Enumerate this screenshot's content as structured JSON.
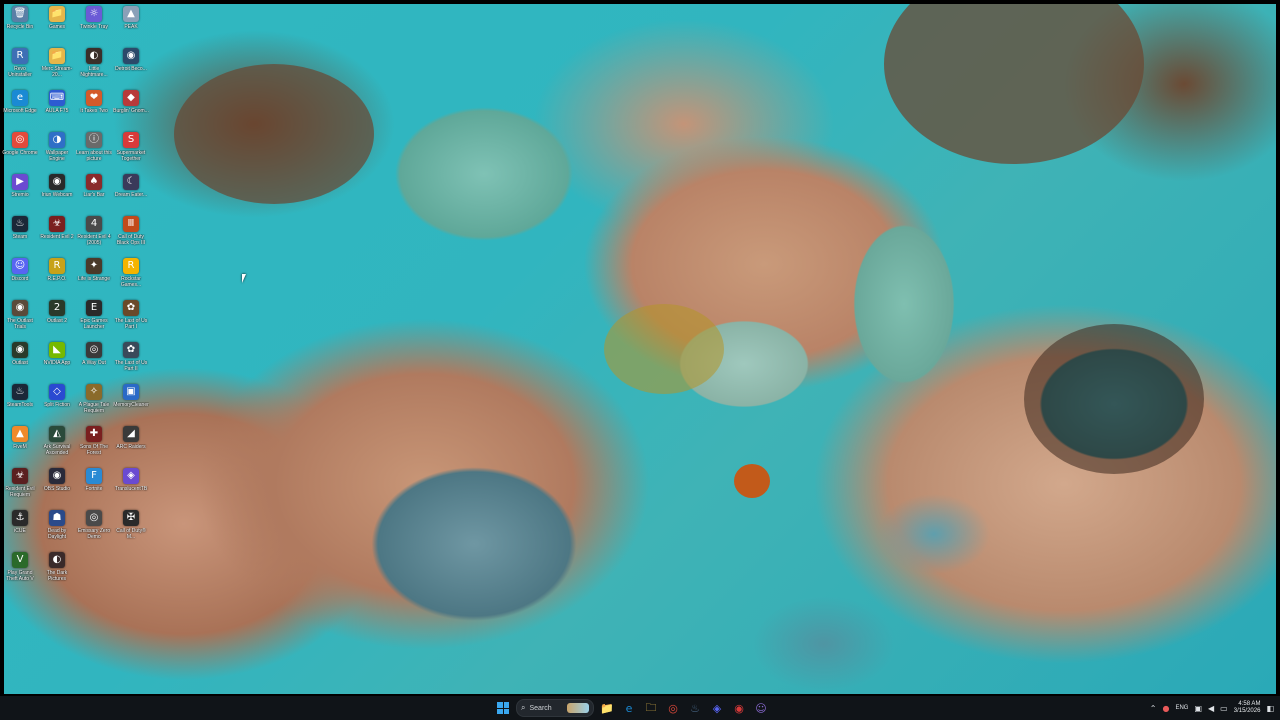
{
  "desktop": {
    "icons": [
      {
        "label": "Recycle Bin",
        "glyph": "🗑",
        "color": "#5a7fa6",
        "icon": "recycle-bin-icon"
      },
      {
        "label": "Games",
        "glyph": "📁",
        "color": "#e6b64a",
        "icon": "folder-icon"
      },
      {
        "label": "Twinkle Tray",
        "glyph": "☼",
        "color": "#6b5bd6",
        "icon": "twinkle-tray-icon"
      },
      {
        "label": "PEAK",
        "glyph": "▲",
        "color": "#8aa0b8",
        "icon": "peak-icon"
      },
      {
        "label": "Revo Uninstaller",
        "glyph": "R",
        "color": "#3d6fb5",
        "icon": "revo-icon"
      },
      {
        "label": "Merc Stream-20...",
        "glyph": "📁",
        "color": "#e6b64a",
        "icon": "folder-icon"
      },
      {
        "label": "Little Nightmare...",
        "glyph": "◐",
        "color": "#3a2f2a",
        "icon": "little-nightmares-icon"
      },
      {
        "label": "Detroit Beco...",
        "glyph": "◉",
        "color": "#2b4a6a",
        "icon": "detroit-icon"
      },
      {
        "label": "Microsoft Edge",
        "glyph": "e",
        "color": "#1a8ad4",
        "icon": "edge-icon"
      },
      {
        "label": "AULA F75",
        "glyph": "⌨",
        "color": "#2d5bd1",
        "icon": "aula-icon"
      },
      {
        "label": "It Takes Two",
        "glyph": "❤",
        "color": "#d45a2a",
        "icon": "it-takes-two-icon"
      },
      {
        "label": "Burglin' Gnom...",
        "glyph": "◆",
        "color": "#b83a3a",
        "icon": "burglin-gnomes-icon"
      },
      {
        "label": "Google Chrome",
        "glyph": "◎",
        "color": "#e34a3b",
        "icon": "chrome-icon"
      },
      {
        "label": "Wallpaper Engine",
        "glyph": "◑",
        "color": "#2f6fc7",
        "icon": "wallpaper-engine-icon"
      },
      {
        "label": "Learn about this picture",
        "glyph": "ⓘ",
        "color": "#6a6a6a",
        "icon": "info-icon"
      },
      {
        "label": "Supermarket Together",
        "glyph": "S",
        "color": "#d83a3a",
        "icon": "supermarket-icon"
      },
      {
        "label": "Stremio",
        "glyph": "▶",
        "color": "#6b4bd1",
        "icon": "stremio-icon"
      },
      {
        "label": "Iriun Webcam",
        "glyph": "◉",
        "color": "#2a2a2a",
        "icon": "webcam-icon"
      },
      {
        "label": "Liar's Bar",
        "glyph": "♠",
        "color": "#8a2b2b",
        "icon": "liars-bar-icon"
      },
      {
        "label": "Dream Eater...",
        "glyph": "☾",
        "color": "#3a3a5a",
        "icon": "dream-icon"
      },
      {
        "label": "Steam",
        "glyph": "♨",
        "color": "#1b2838",
        "icon": "steam-icon"
      },
      {
        "label": "Resident Evil 2",
        "glyph": "☣",
        "color": "#7a1f1f",
        "icon": "resident-evil-icon"
      },
      {
        "label": "Resident Evil 4 (2005)",
        "glyph": "4",
        "color": "#4a4a4a",
        "icon": "resident-evil-icon"
      },
      {
        "label": "Call of Duty Black Ops III",
        "glyph": "Ⅲ",
        "color": "#c24a1a",
        "icon": "cod-icon"
      },
      {
        "label": "Discord",
        "glyph": "☺",
        "color": "#5865f2",
        "icon": "discord-icon"
      },
      {
        "label": "R.E.P.O.",
        "glyph": "R",
        "color": "#c7a21a",
        "icon": "repo-icon"
      },
      {
        "label": "Life is Strange",
        "glyph": "✦",
        "color": "#4a3a2a",
        "icon": "life-is-strange-icon"
      },
      {
        "label": "Rockstar Games...",
        "glyph": "R",
        "color": "#f4b400",
        "icon": "rockstar-icon"
      },
      {
        "label": "The Outlast Trials",
        "glyph": "◉",
        "color": "#5a4a3a",
        "icon": "outlast-icon"
      },
      {
        "label": "Outlast 2",
        "glyph": "2",
        "color": "#2a3a2a",
        "icon": "outlast-icon"
      },
      {
        "label": "Epic Games Launcher",
        "glyph": "E",
        "color": "#2a2a2a",
        "icon": "epic-games-icon"
      },
      {
        "label": "The Last of Us Part I",
        "glyph": "✿",
        "color": "#6a4a2a",
        "icon": "last-of-us-icon"
      },
      {
        "label": "Outlast",
        "glyph": "◉",
        "color": "#2a3a2a",
        "icon": "outlast-icon"
      },
      {
        "label": "NVIDIA App",
        "glyph": "◣",
        "color": "#76b900",
        "icon": "nvidia-icon"
      },
      {
        "label": "A Way Out",
        "glyph": "◎",
        "color": "#3a3a3a",
        "icon": "a-way-out-icon"
      },
      {
        "label": "The Last of Us Part II",
        "glyph": "✿",
        "color": "#3a4a5a",
        "icon": "last-of-us-icon"
      },
      {
        "label": "SteamTools",
        "glyph": "♨",
        "color": "#1b2838",
        "icon": "steamtools-icon"
      },
      {
        "label": "Split Fiction",
        "glyph": "◇",
        "color": "#2a4ad1",
        "icon": "split-fiction-icon"
      },
      {
        "label": "A Plague Tale Requiem",
        "glyph": "✧",
        "color": "#8a6a2a",
        "icon": "plague-tale-icon"
      },
      {
        "label": "MemoryCleaner",
        "glyph": "▣",
        "color": "#2a6ac7",
        "icon": "memory-cleaner-icon"
      },
      {
        "label": "FiveM",
        "glyph": "▲",
        "color": "#f08a2a",
        "icon": "fivem-icon"
      },
      {
        "label": "Ark Survival Ascended",
        "glyph": "◭",
        "color": "#2a4a3a",
        "icon": "ark-icon"
      },
      {
        "label": "Sons Of The Forest",
        "glyph": "✚",
        "color": "#7a1f1f",
        "icon": "sons-forest-icon"
      },
      {
        "label": "ARC Raiders",
        "glyph": "◢",
        "color": "#3a3a3a",
        "icon": "arc-raiders-icon"
      },
      {
        "label": "Resident Evil Requiem",
        "glyph": "☣",
        "color": "#5a1f1f",
        "icon": "resident-evil-icon"
      },
      {
        "label": "OBS Studio",
        "glyph": "◉",
        "color": "#2a2a3a",
        "icon": "obs-icon"
      },
      {
        "label": "Fortnite",
        "glyph": "F",
        "color": "#2a8ad4",
        "icon": "fortnite-icon"
      },
      {
        "label": "TranslucentTB",
        "glyph": "◈",
        "color": "#6a4bd1",
        "icon": "translucent-icon"
      },
      {
        "label": "iCUE",
        "glyph": "⚓",
        "color": "#2a2a2a",
        "icon": "icue-icon"
      },
      {
        "label": "Dead by Daylight",
        "glyph": "☗",
        "color": "#2a4a8a",
        "icon": "dbd-icon"
      },
      {
        "label": "Emissary Zero Demo",
        "glyph": "◎",
        "color": "#4a4a4a",
        "icon": "emissary-icon"
      },
      {
        "label": "Call of Duty® M...",
        "glyph": "✠",
        "color": "#2a2a2a",
        "icon": "cod-icon"
      },
      {
        "label": "Play Grand Theft Auto V",
        "glyph": "V",
        "color": "#2a6a2a",
        "icon": "gta-icon"
      },
      {
        "label": "The Dark Pictures",
        "glyph": "◐",
        "color": "#3a2a2a",
        "icon": "dark-pictures-icon"
      }
    ]
  },
  "taskbar": {
    "search_label": "Search",
    "apps": [
      {
        "name": "file-explorer",
        "glyph": "📁",
        "color": "#e6b64a"
      },
      {
        "name": "edge",
        "glyph": "e",
        "color": "#1a8ad4"
      },
      {
        "name": "files",
        "glyph": "🗀",
        "color": "#f0c24a"
      },
      {
        "name": "chrome",
        "glyph": "◎",
        "color": "#e34a3b"
      },
      {
        "name": "steam",
        "glyph": "♨",
        "color": "#4a6a8a"
      },
      {
        "name": "epic",
        "glyph": "◈",
        "color": "#5865f2"
      },
      {
        "name": "recorder",
        "glyph": "◉",
        "color": "#d83a3a"
      },
      {
        "name": "discord",
        "glyph": "☺",
        "color": "#8a6ad1"
      }
    ],
    "tray": {
      "language": "ENG",
      "time": "4:58 AM",
      "date": "3/15/2026"
    }
  }
}
